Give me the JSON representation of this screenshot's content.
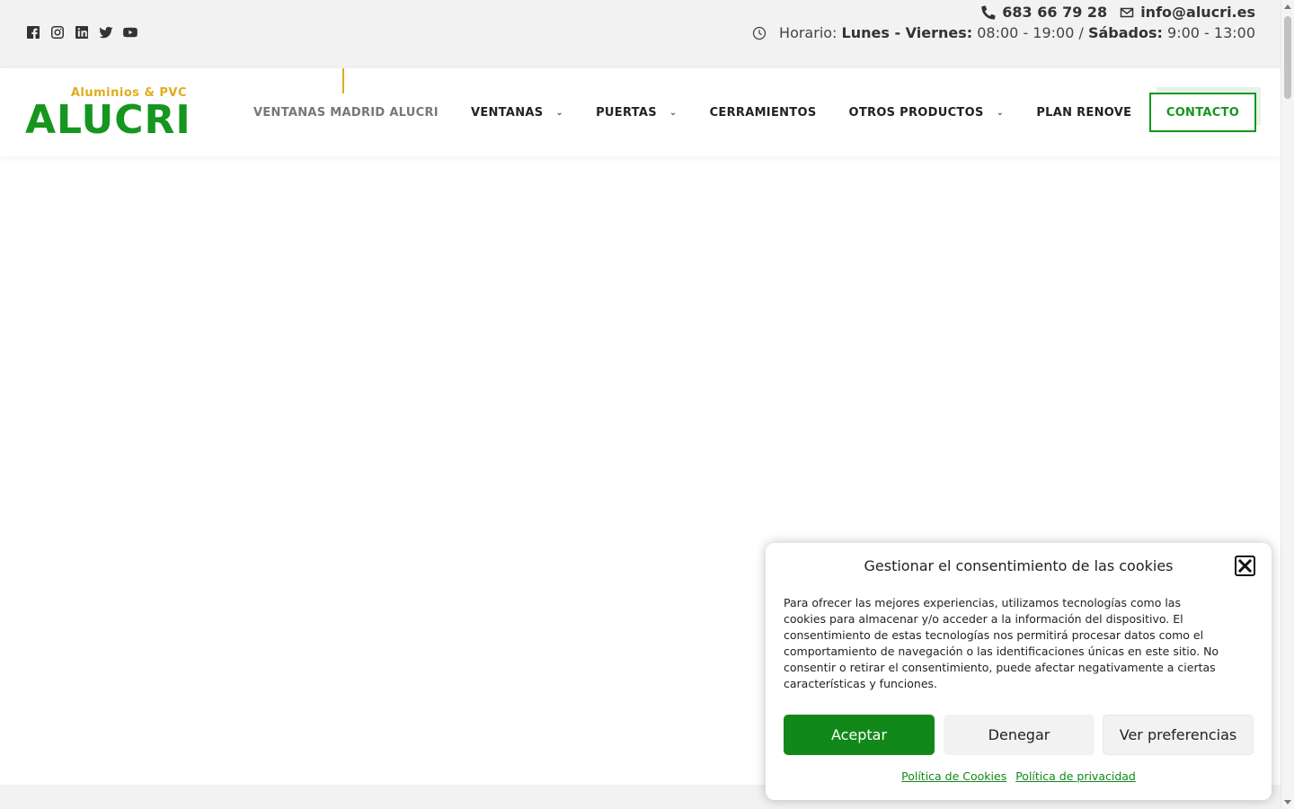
{
  "topbar": {
    "social": [
      "facebook-icon",
      "instagram-icon",
      "linkedin-icon",
      "twitter-icon",
      "youtube-icon"
    ],
    "phone": "683 66 79 28",
    "email": "info@alucri.es",
    "hours": {
      "label": "Horario:",
      "weekdays_label": "Lunes - Viernes:",
      "weekdays_time": "08:00 - 19:00 /",
      "saturday_label": "Sábados:",
      "saturday_time": "9:00 - 13:00"
    }
  },
  "logo": {
    "tagline": "Aluminios & PVC",
    "name": "ALUCRI"
  },
  "nav": {
    "items": [
      {
        "label": "VENTANAS MADRID ALUCRI",
        "dropdown": false
      },
      {
        "label": "VENTANAS",
        "dropdown": true
      },
      {
        "label": "PUERTAS",
        "dropdown": true
      },
      {
        "label": "CERRAMIENTOS",
        "dropdown": false
      },
      {
        "label": "OTROS PRODUCTOS",
        "dropdown": true
      },
      {
        "label": "PLAN RENOVE",
        "dropdown": false
      }
    ],
    "cta": "CONTACTO"
  },
  "cookie": {
    "title": "Gestionar el consentimiento de las cookies",
    "body": "Para ofrecer las mejores experiencias, utilizamos tecnologías como las cookies para almacenar y/o acceder a la información del dispositivo. El consentimiento de estas tecnologías nos permitirá procesar datos como el comportamiento de navegación o las identificaciones únicas en este sitio. No consentir o retirar el consentimiento, puede afectar negativamente a ciertas características y funciones.",
    "accept": "Aceptar",
    "deny": "Denegar",
    "preferences": "Ver preferencias",
    "cookie_policy": "Política de Cookies",
    "privacy_policy": "Política de privacidad"
  },
  "colors": {
    "brand_green": "#16961e",
    "brand_yellow": "#e0ac1c",
    "topbar_bg": "#f2f2f2"
  }
}
